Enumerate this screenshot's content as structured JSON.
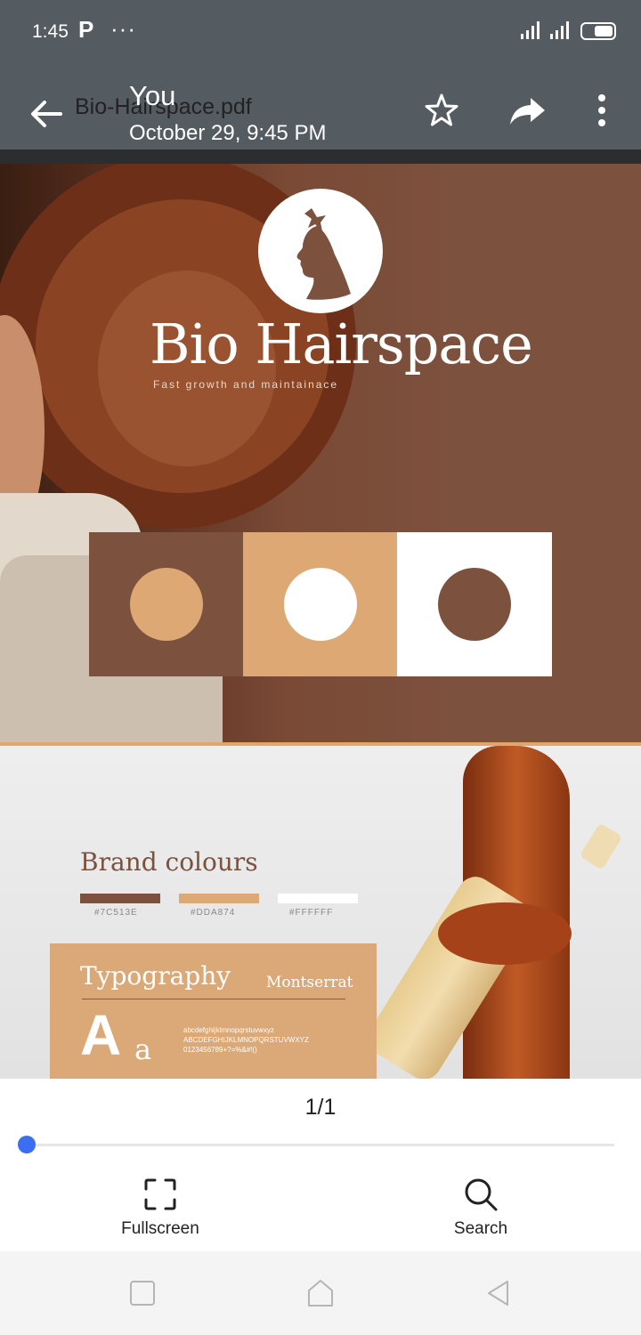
{
  "status_bar": {
    "time": "1:45",
    "app_glyph": "P",
    "more": "···",
    "icons": [
      "signal-icon",
      "signal-icon",
      "battery-icon"
    ]
  },
  "header": {
    "file_name": "Bio-Hairspace.pdf",
    "sender": "You",
    "date": "October 29, 9:45 PM",
    "icons": [
      "back-arrow-icon",
      "star-icon",
      "share-icon",
      "more-vert-icon"
    ]
  },
  "document": {
    "brand_name": "Bio Hairspace",
    "tagline": "Fast growth and maintainace",
    "brand_colours_title": "Brand colours",
    "colours": [
      {
        "hex_label": "#7C513E",
        "value": "#7c513e"
      },
      {
        "hex_label": "#DDA874",
        "value": "#dda874"
      },
      {
        "hex_label": "#FFFFFF",
        "value": "#ffffff"
      }
    ],
    "typography_title": "Typography",
    "font_name": "Montserrat",
    "big_letter": "A",
    "small_letter": "a",
    "char_lines": [
      "abcdefghijklmnopqrstuvwxyz",
      "ABCDEFGHIJKLMNOPQRSTUVWXYZ",
      "0123456789+?=%&#!()"
    ]
  },
  "viewer": {
    "page_indicator": "1/1",
    "progress": 0,
    "fullscreen_label": "Fullscreen",
    "search_label": "Search"
  },
  "nav_bar": {
    "icons": [
      "recents-square-icon",
      "home-icon",
      "back-triangle-icon"
    ]
  },
  "colors": {
    "bar_bg": "#545b61",
    "accent": "#3b6ef0",
    "brand_brown": "#7c513e",
    "brand_tan": "#dda874"
  }
}
